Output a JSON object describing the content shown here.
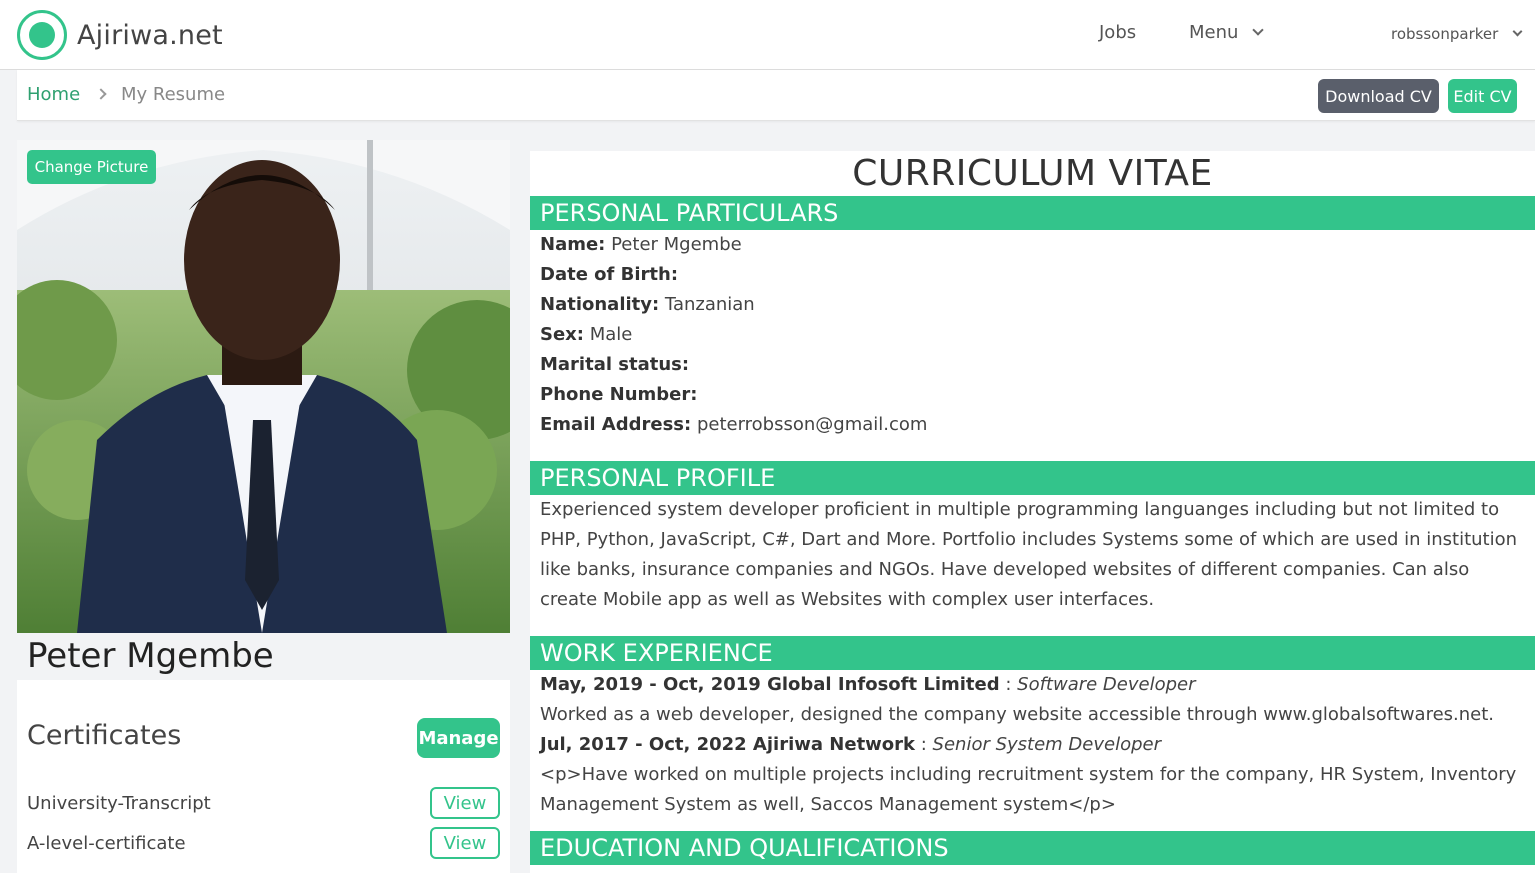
{
  "navbar": {
    "brand": "Ajiriwa.net",
    "links": {
      "jobs": "Jobs",
      "menu": "Menu"
    },
    "user": "robssonparker"
  },
  "breadcrumb": {
    "home": "Home",
    "current": "My Resume"
  },
  "actions": {
    "download": "Download CV",
    "edit": "Edit CV",
    "change_picture": "Change Picture"
  },
  "profile": {
    "name": "Peter Mgembe"
  },
  "certificates": {
    "title": "Certificates",
    "manage": "Manage",
    "items": [
      {
        "name": "University-Transcript",
        "action": "View"
      },
      {
        "name": "A-level-certificate",
        "action": "View"
      }
    ]
  },
  "cv": {
    "title": "CURRICULUM VITAE",
    "sections": {
      "personal_particulars": "PERSONAL PARTICULARS",
      "personal_profile": "PERSONAL PROFILE",
      "work_experience": "WORK EXPERIENCE",
      "education": "EDUCATION AND QUALIFICATIONS"
    },
    "particulars": {
      "name_label": "Name:",
      "name_value": " Peter Mgembe",
      "dob_label": "Date of Birth:",
      "dob_value": "",
      "nationality_label": "Nationality:",
      "nationality_value": " Tanzanian",
      "sex_label": "Sex:",
      "sex_value": " Male",
      "marital_label": "Marital status:",
      "marital_value": "",
      "phone_label": "Phone Number:",
      "phone_value": "",
      "email_label": "Email Address:",
      "email_value": " peterrobsson@gmail.com"
    },
    "profile_text": "Experienced system developer proficient in multiple programming languanges including but not limited to PHP, Python, JavaScript, C#, Dart and More. Portfolio includes Systems some of which are used in institution like banks, insurance companies and NGOs. Have developed websites of different companies. Can also create Mobile app as well as Websites with complex user interfaces.",
    "work": [
      {
        "period_company": "May, 2019 - Oct, 2019 Global Infosoft Limited",
        "separator": " : ",
        "role": "Software Developer",
        "description": "Worked as a web developer, designed the company website accessible through www.globalsoftwares.net."
      },
      {
        "period_company": "Jul, 2017 - Oct, 2022 Ajiriwa Network",
        "separator": " : ",
        "role": "Senior System Developer",
        "description": "<p>Have worked on multiple projects including recruitment system for the company, HR System, Inventory Management System as well, Saccos Management system</p>"
      }
    ]
  }
}
